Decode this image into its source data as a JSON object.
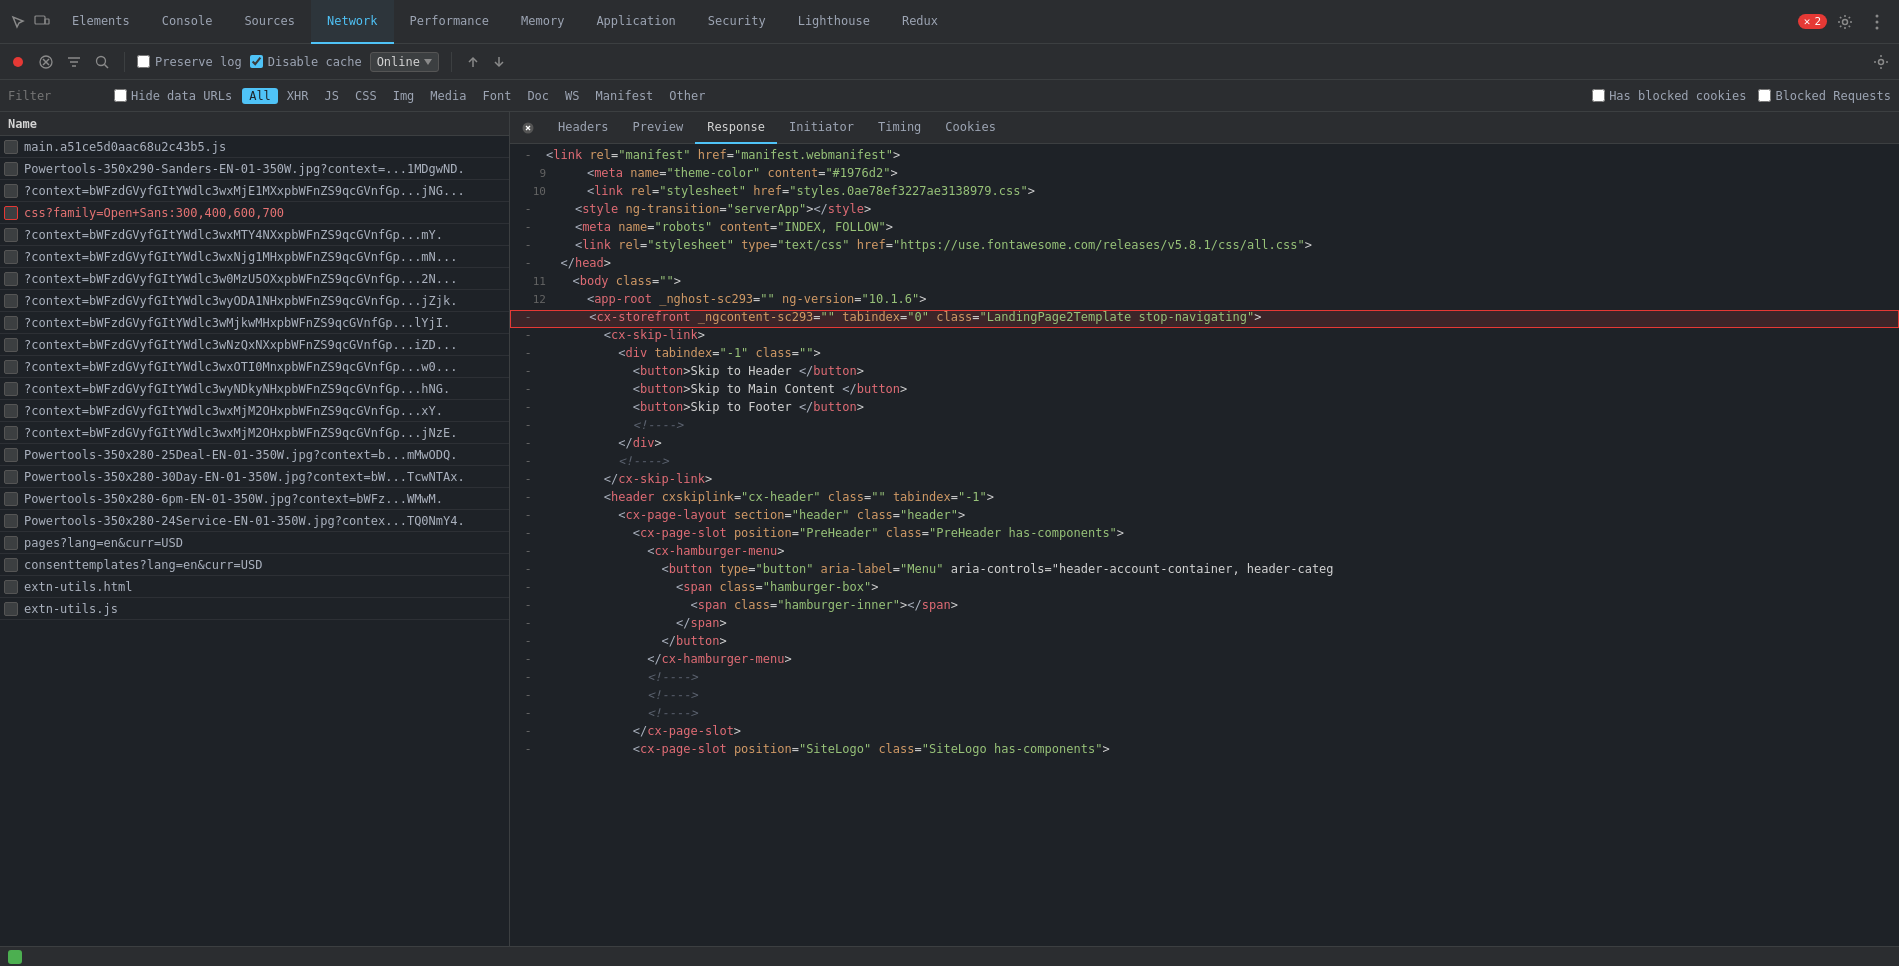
{
  "tabs": {
    "items": [
      {
        "label": "Elements",
        "active": false
      },
      {
        "label": "Console",
        "active": false
      },
      {
        "label": "Sources",
        "active": false
      },
      {
        "label": "Network",
        "active": true
      },
      {
        "label": "Performance",
        "active": false
      },
      {
        "label": "Memory",
        "active": false
      },
      {
        "label": "Application",
        "active": false
      },
      {
        "label": "Security",
        "active": false
      },
      {
        "label": "Lighthouse",
        "active": false
      },
      {
        "label": "Redux",
        "active": false
      }
    ],
    "error_count": "2",
    "settings_icon": "gear",
    "more_icon": "ellipsis"
  },
  "network_toolbar": {
    "record_label": "record",
    "clear_label": "clear",
    "filter_label": "filter",
    "search_label": "search",
    "preserve_log_label": "Preserve log",
    "disable_cache_label": "Disable cache",
    "throttle_label": "Online",
    "upload_label": "upload",
    "download_label": "download",
    "settings_label": "settings"
  },
  "filter_bar": {
    "placeholder": "Filter",
    "hide_data_urls_label": "Hide data URLs",
    "filter_all_label": "All",
    "filter_types": [
      "XHR",
      "JS",
      "CSS",
      "Img",
      "Media",
      "Font",
      "Doc",
      "WS",
      "Manifest",
      "Other"
    ],
    "has_blocked_cookies_label": "Has blocked cookies",
    "blocked_requests_label": "Blocked Requests"
  },
  "requests": {
    "header": "Name",
    "items": [
      {
        "name": "main.a51ce5d0aac68u2c43b5.js",
        "red": false,
        "selected": false
      },
      {
        "name": "Powertools-350x290-Sanders-EN-01-350W.jpg?context=...1MDgwND.",
        "red": false,
        "selected": false
      },
      {
        "name": "?context=bWFzdGVyfGItYWdlc3wxMjE1MXxpbWFnZS9qcGVnfGp...jNG...",
        "red": false,
        "selected": false
      },
      {
        "name": "css?family=Open+Sans:300,400,600,700",
        "red": true,
        "selected": false
      },
      {
        "name": "?context=bWFzdGVyfGItYWdlc3wxMTY4NXxpbWFnZS9qcGVnfGp...mY.",
        "red": false,
        "selected": false
      },
      {
        "name": "?context=bWFzdGVyfGItYWdlc3wxNjg1MHxpbWFnZS9qcGVnfGp...mN...",
        "red": false,
        "selected": false
      },
      {
        "name": "?context=bWFzdGVyfGItYWdlc3w0MzU5OXxpbWFnZS9qcGVnfGp...2N...",
        "red": false,
        "selected": false
      },
      {
        "name": "?context=bWFzdGVyfGItYWdlc3wyODA1NHxpbWFnZS9qcGVnfGp...jZjk.",
        "red": false,
        "selected": false
      },
      {
        "name": "?context=bWFzdGVyfGItYWdlc3wMjkwMHxpbWFnZS9qcGVnfGp...lYjI.",
        "red": false,
        "selected": false
      },
      {
        "name": "?context=bWFzdGVyfGItYWdlc3wNzQxNXxpbWFnZS9qcGVnfGp...iZD...",
        "red": false,
        "selected": false
      },
      {
        "name": "?context=bWFzdGVyfGItYWdlc3wxOTI0MnxpbWFnZS9qcGVnfGp...w0...",
        "red": false,
        "selected": false
      },
      {
        "name": "?context=bWFzdGVyfGItYWdlc3wyNDkyNHxpbWFnZS9qcGVnfGp...hNG.",
        "red": false,
        "selected": false
      },
      {
        "name": "?context=bWFzdGVyfGItYWdlc3wxMjM2OHxpbWFnZS9qcGVnfGp...xY.",
        "red": false,
        "selected": false
      },
      {
        "name": "?context=bWFzdGVyfGItYWdlc3wxMjM2OHxpbWFnZS9qcGVnfGp...jNzE.",
        "red": false,
        "selected": false
      },
      {
        "name": "Powertools-350x280-25Deal-EN-01-350W.jpg?context=b...mMwODQ.",
        "red": false,
        "selected": false
      },
      {
        "name": "Powertools-350x280-30Day-EN-01-350W.jpg?context=bW...TcwNTAx.",
        "red": false,
        "selected": false
      },
      {
        "name": "Powertools-350x280-6pm-EN-01-350W.jpg?context=bWFz...WMwM.",
        "red": false,
        "selected": false
      },
      {
        "name": "Powertools-350x280-24Service-EN-01-350W.jpg?contex...TQ0NmY4.",
        "red": false,
        "selected": false
      },
      {
        "name": "pages?lang=en&curr=USD",
        "red": false,
        "selected": false
      },
      {
        "name": "consenttemplates?lang=en&curr=USD",
        "red": false,
        "selected": false
      },
      {
        "name": "extn-utils.html",
        "red": false,
        "selected": false
      },
      {
        "name": "extn-utils.js",
        "red": false,
        "selected": false
      }
    ]
  },
  "response_panel": {
    "tabs": [
      "Headers",
      "Preview",
      "Response",
      "Initiator",
      "Timing",
      "Cookies"
    ],
    "active_tab": "Response",
    "close_icon": "close"
  },
  "code_lines": [
    {
      "num": "",
      "dash": true,
      "content": "<link rel=\"manifest\" href=\"manifest.webmanifest\">",
      "highlight": false,
      "type": "html"
    },
    {
      "num": "9",
      "dash": false,
      "content": "    <meta name=\"theme-color\" content=\"#1976d2\">",
      "highlight": false,
      "type": "html"
    },
    {
      "num": "10",
      "dash": false,
      "content": "    <link rel=\"stylesheet\" href=\"styles.0ae78ef3227ae3138979.css\">",
      "highlight": false,
      "type": "html"
    },
    {
      "num": "",
      "dash": true,
      "content": "    <style ng-transition=\"serverApp\"></style>",
      "highlight": false,
      "type": "html"
    },
    {
      "num": "",
      "dash": true,
      "content": "    <meta name=\"robots\" content=\"INDEX, FOLLOW\">",
      "highlight": false,
      "type": "html"
    },
    {
      "num": "",
      "dash": true,
      "content": "    <link rel=\"stylesheet\" type=\"text/css\" href=\"https://use.fontawesome.com/releases/v5.8.1/css/all.css\">",
      "highlight": false,
      "type": "html"
    },
    {
      "num": "",
      "dash": true,
      "content": "  </head>",
      "highlight": false,
      "type": "html"
    },
    {
      "num": "11",
      "dash": false,
      "content": "  <body class=\"\">",
      "highlight": false,
      "type": "html"
    },
    {
      "num": "12",
      "dash": false,
      "content": "    <app-root _nghost-sc293=\"\" ng-version=\"10.1.6\">",
      "highlight": false,
      "type": "html"
    },
    {
      "num": "",
      "dash": true,
      "content": "      <cx-storefront _ngcontent-sc293=\"\" tabindex=\"0\" class=\"LandingPage2Template stop-navigating\">",
      "highlight": true,
      "type": "html"
    },
    {
      "num": "",
      "dash": true,
      "content": "        <cx-skip-link>",
      "highlight": false,
      "type": "html"
    },
    {
      "num": "",
      "dash": true,
      "content": "          <div tabindex=\"-1\" class=\"\">",
      "highlight": false,
      "type": "html"
    },
    {
      "num": "",
      "dash": true,
      "content": "            <button>Skip to Header </button>",
      "highlight": false,
      "type": "html"
    },
    {
      "num": "",
      "dash": true,
      "content": "            <button>Skip to Main Content </button>",
      "highlight": false,
      "type": "html"
    },
    {
      "num": "",
      "dash": true,
      "content": "            <button>Skip to Footer </button>",
      "highlight": false,
      "type": "html"
    },
    {
      "num": "",
      "dash": true,
      "content": "            <!---->",
      "highlight": false,
      "type": "comment"
    },
    {
      "num": "",
      "dash": true,
      "content": "          </div>",
      "highlight": false,
      "type": "html"
    },
    {
      "num": "",
      "dash": true,
      "content": "          <!---->",
      "highlight": false,
      "type": "comment"
    },
    {
      "num": "",
      "dash": true,
      "content": "        </cx-skip-link>",
      "highlight": false,
      "type": "html"
    },
    {
      "num": "",
      "dash": true,
      "content": "        <header cxskiplink=\"cx-header\" class=\"\" tabindex=\"-1\">",
      "highlight": false,
      "type": "html"
    },
    {
      "num": "",
      "dash": true,
      "content": "          <cx-page-layout section=\"header\" class=\"header\">",
      "highlight": false,
      "type": "html"
    },
    {
      "num": "",
      "dash": true,
      "content": "            <cx-page-slot position=\"PreHeader\" class=\"PreHeader has-components\">",
      "highlight": false,
      "type": "html"
    },
    {
      "num": "",
      "dash": true,
      "content": "              <cx-hamburger-menu>",
      "highlight": false,
      "type": "html"
    },
    {
      "num": "",
      "dash": true,
      "content": "                <button type=\"button\" aria-label=\"Menu\" aria-controls=\"header-account-container, header-categ",
      "highlight": false,
      "type": "html"
    },
    {
      "num": "",
      "dash": true,
      "content": "                  <span class=\"hamburger-box\">",
      "highlight": false,
      "type": "html"
    },
    {
      "num": "",
      "dash": true,
      "content": "                    <span class=\"hamburger-inner\"></span>",
      "highlight": false,
      "type": "html"
    },
    {
      "num": "",
      "dash": true,
      "content": "                  </span>",
      "highlight": false,
      "type": "html"
    },
    {
      "num": "",
      "dash": true,
      "content": "                </button>",
      "highlight": false,
      "type": "html"
    },
    {
      "num": "",
      "dash": true,
      "content": "              </cx-hamburger-menu>",
      "highlight": false,
      "type": "html"
    },
    {
      "num": "",
      "dash": true,
      "content": "              <!---->",
      "highlight": false,
      "type": "comment"
    },
    {
      "num": "",
      "dash": true,
      "content": "              <!---->",
      "highlight": false,
      "type": "comment"
    },
    {
      "num": "",
      "dash": true,
      "content": "              <!---->",
      "highlight": false,
      "type": "comment"
    },
    {
      "num": "",
      "dash": true,
      "content": "            </cx-page-slot>",
      "highlight": false,
      "type": "html"
    },
    {
      "num": "",
      "dash": true,
      "content": "            <cx-page-slot position=\"SiteLogo\" class=\"SiteLogo has-components\">",
      "highlight": false,
      "type": "html"
    }
  ]
}
